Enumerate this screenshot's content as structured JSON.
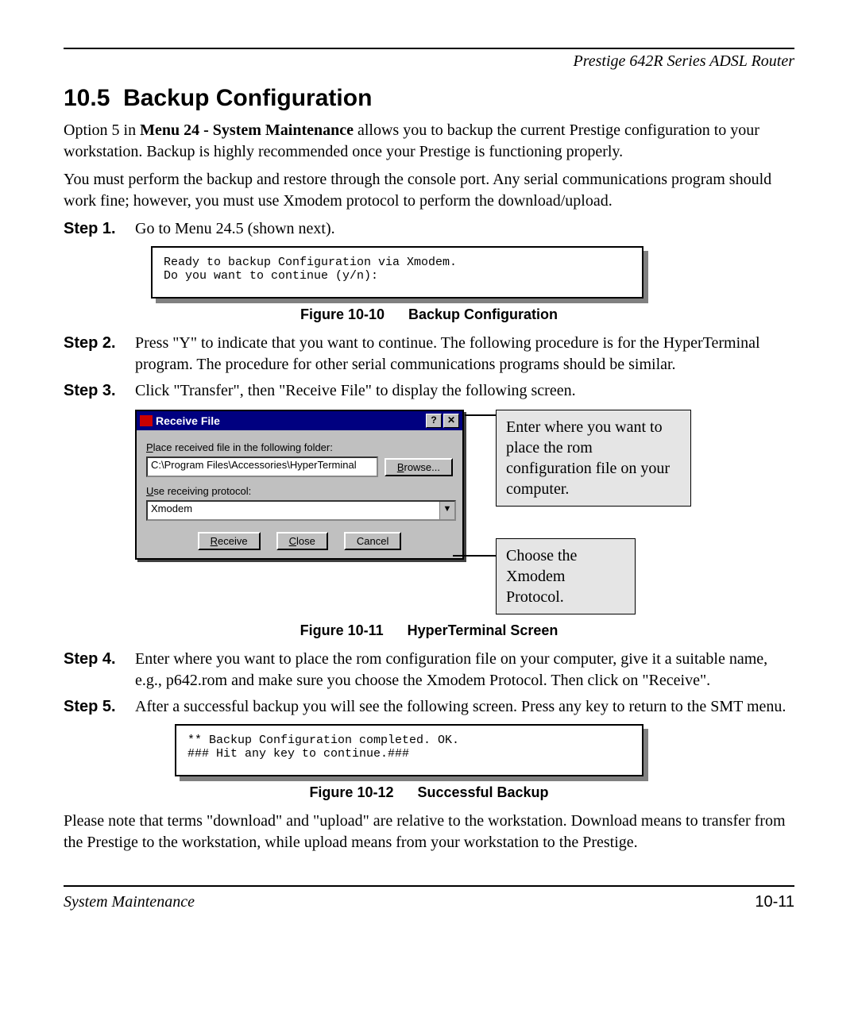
{
  "header": {
    "product": "Prestige 642R Series ADSL Router"
  },
  "section": {
    "number": "10.5",
    "title": "Backup Configuration",
    "intro_p1_a": "Option 5 in ",
    "intro_bold": "Menu 24 - System Maintenance",
    "intro_p1_b": " allows you to backup the current Prestige configuration to your workstation. Backup is highly recommended once your Prestige is functioning properly.",
    "intro_p2": "You must perform the backup and restore through the console port. Any serial communications program should work fine; however, you must use Xmodem protocol to perform the download/upload."
  },
  "steps": {
    "s1_label": "Step 1.",
    "s1_text": "Go to Menu 24.5 (shown next).",
    "s2_label": "Step 2.",
    "s2_text": "Press \"Y\" to indicate that you want to continue. The following procedure is for the HyperTerminal program. The procedure for other serial communications programs should be similar.",
    "s3_label": "Step 3.",
    "s3_text": "Click \"Transfer\", then \"Receive File\" to display the following screen.",
    "s4_label": "Step 4.",
    "s4_text": "Enter where you want to place the rom configuration file on your computer, give it a suitable name, e.g., p642.rom and make sure you choose the Xmodem Protocol. Then click on \"Receive\".",
    "s5_label": "Step 5.",
    "s5_text": "After a successful backup you will see the following screen. Press any key to return to the SMT menu."
  },
  "console1": {
    "line1": "Ready to backup Configuration via Xmodem.",
    "line2": "Do you want to continue (y/n):"
  },
  "console2": {
    "line1": "** Backup Configuration completed. OK.",
    "line2": "### Hit any key to continue.###"
  },
  "captions": {
    "fig10": "Figure 10-10",
    "fig10_title": "Backup Configuration",
    "fig11": "Figure 10-11",
    "fig11_title": "HyperTerminal Screen",
    "fig12": "Figure 10-12",
    "fig12_title": "Successful Backup"
  },
  "dialog": {
    "title": "Receive File",
    "help_btn": "?",
    "close_btn": "✕",
    "label_folder": "Place received file in the following folder:",
    "path_value": "C:\\Program Files\\Accessories\\HyperTerminal",
    "browse_label": "Browse...",
    "label_protocol": "Use receiving protocol:",
    "protocol_value": "Xmodem",
    "btn_receive": "Receive",
    "btn_close": "Close",
    "btn_cancel": "Cancel"
  },
  "callouts": {
    "top": "Enter where you want to place the rom configuration file on your computer.",
    "bot": "Choose the Xmodem Protocol."
  },
  "closing_note": "Please note that terms \"download\" and \"upload\" are relative to the workstation. Download means to transfer from the Prestige to the workstation, while upload means from your workstation to the Prestige.",
  "footer": {
    "left": "System Maintenance",
    "right": "10-11"
  }
}
